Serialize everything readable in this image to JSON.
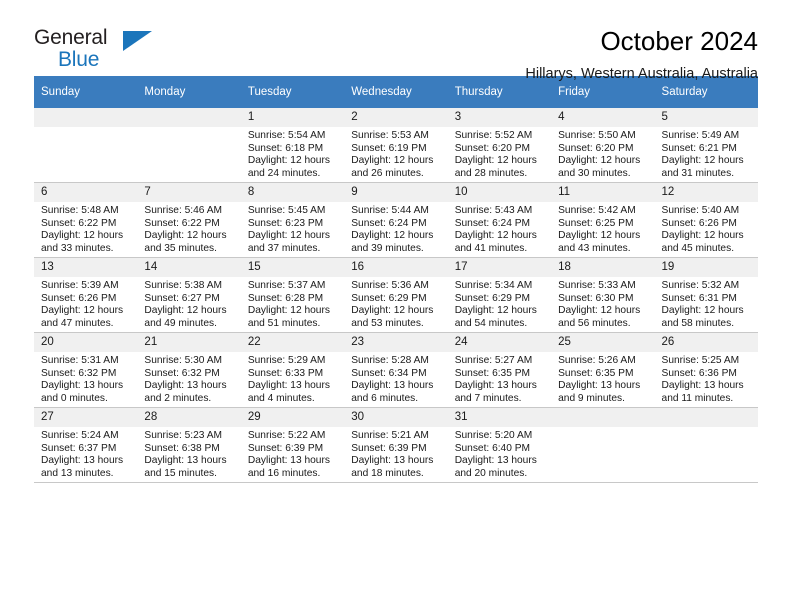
{
  "brand": {
    "name_top": "General",
    "name_bottom": "Blue",
    "triangle_icon": "triangle-icon",
    "accent_color": "#1b75bb"
  },
  "header": {
    "title": "October 2024",
    "subtitle": "Hillarys, Western Australia, Australia"
  },
  "calendar": {
    "header_bg": "#3a7cbe",
    "daynum_bg": "#f0f0f0",
    "weekdays": [
      "Sunday",
      "Monday",
      "Tuesday",
      "Wednesday",
      "Thursday",
      "Friday",
      "Saturday"
    ],
    "labels": {
      "sunrise": "Sunrise:",
      "sunset": "Sunset:",
      "daylight": "Daylight:"
    },
    "weeks": [
      [
        {
          "day": "",
          "empty": true
        },
        {
          "day": "",
          "empty": true
        },
        {
          "day": "1",
          "sunrise": "Sunrise: 5:54 AM",
          "sunset": "Sunset: 6:18 PM",
          "daylight_1": "Daylight: 12 hours",
          "daylight_2": "and 24 minutes."
        },
        {
          "day": "2",
          "sunrise": "Sunrise: 5:53 AM",
          "sunset": "Sunset: 6:19 PM",
          "daylight_1": "Daylight: 12 hours",
          "daylight_2": "and 26 minutes."
        },
        {
          "day": "3",
          "sunrise": "Sunrise: 5:52 AM",
          "sunset": "Sunset: 6:20 PM",
          "daylight_1": "Daylight: 12 hours",
          "daylight_2": "and 28 minutes."
        },
        {
          "day": "4",
          "sunrise": "Sunrise: 5:50 AM",
          "sunset": "Sunset: 6:20 PM",
          "daylight_1": "Daylight: 12 hours",
          "daylight_2": "and 30 minutes."
        },
        {
          "day": "5",
          "sunrise": "Sunrise: 5:49 AM",
          "sunset": "Sunset: 6:21 PM",
          "daylight_1": "Daylight: 12 hours",
          "daylight_2": "and 31 minutes."
        }
      ],
      [
        {
          "day": "6",
          "sunrise": "Sunrise: 5:48 AM",
          "sunset": "Sunset: 6:22 PM",
          "daylight_1": "Daylight: 12 hours",
          "daylight_2": "and 33 minutes."
        },
        {
          "day": "7",
          "sunrise": "Sunrise: 5:46 AM",
          "sunset": "Sunset: 6:22 PM",
          "daylight_1": "Daylight: 12 hours",
          "daylight_2": "and 35 minutes."
        },
        {
          "day": "8",
          "sunrise": "Sunrise: 5:45 AM",
          "sunset": "Sunset: 6:23 PM",
          "daylight_1": "Daylight: 12 hours",
          "daylight_2": "and 37 minutes."
        },
        {
          "day": "9",
          "sunrise": "Sunrise: 5:44 AM",
          "sunset": "Sunset: 6:24 PM",
          "daylight_1": "Daylight: 12 hours",
          "daylight_2": "and 39 minutes."
        },
        {
          "day": "10",
          "sunrise": "Sunrise: 5:43 AM",
          "sunset": "Sunset: 6:24 PM",
          "daylight_1": "Daylight: 12 hours",
          "daylight_2": "and 41 minutes."
        },
        {
          "day": "11",
          "sunrise": "Sunrise: 5:42 AM",
          "sunset": "Sunset: 6:25 PM",
          "daylight_1": "Daylight: 12 hours",
          "daylight_2": "and 43 minutes."
        },
        {
          "day": "12",
          "sunrise": "Sunrise: 5:40 AM",
          "sunset": "Sunset: 6:26 PM",
          "daylight_1": "Daylight: 12 hours",
          "daylight_2": "and 45 minutes."
        }
      ],
      [
        {
          "day": "13",
          "sunrise": "Sunrise: 5:39 AM",
          "sunset": "Sunset: 6:26 PM",
          "daylight_1": "Daylight: 12 hours",
          "daylight_2": "and 47 minutes."
        },
        {
          "day": "14",
          "sunrise": "Sunrise: 5:38 AM",
          "sunset": "Sunset: 6:27 PM",
          "daylight_1": "Daylight: 12 hours",
          "daylight_2": "and 49 minutes."
        },
        {
          "day": "15",
          "sunrise": "Sunrise: 5:37 AM",
          "sunset": "Sunset: 6:28 PM",
          "daylight_1": "Daylight: 12 hours",
          "daylight_2": "and 51 minutes."
        },
        {
          "day": "16",
          "sunrise": "Sunrise: 5:36 AM",
          "sunset": "Sunset: 6:29 PM",
          "daylight_1": "Daylight: 12 hours",
          "daylight_2": "and 53 minutes."
        },
        {
          "day": "17",
          "sunrise": "Sunrise: 5:34 AM",
          "sunset": "Sunset: 6:29 PM",
          "daylight_1": "Daylight: 12 hours",
          "daylight_2": "and 54 minutes."
        },
        {
          "day": "18",
          "sunrise": "Sunrise: 5:33 AM",
          "sunset": "Sunset: 6:30 PM",
          "daylight_1": "Daylight: 12 hours",
          "daylight_2": "and 56 minutes."
        },
        {
          "day": "19",
          "sunrise": "Sunrise: 5:32 AM",
          "sunset": "Sunset: 6:31 PM",
          "daylight_1": "Daylight: 12 hours",
          "daylight_2": "and 58 minutes."
        }
      ],
      [
        {
          "day": "20",
          "sunrise": "Sunrise: 5:31 AM",
          "sunset": "Sunset: 6:32 PM",
          "daylight_1": "Daylight: 13 hours",
          "daylight_2": "and 0 minutes."
        },
        {
          "day": "21",
          "sunrise": "Sunrise: 5:30 AM",
          "sunset": "Sunset: 6:32 PM",
          "daylight_1": "Daylight: 13 hours",
          "daylight_2": "and 2 minutes."
        },
        {
          "day": "22",
          "sunrise": "Sunrise: 5:29 AM",
          "sunset": "Sunset: 6:33 PM",
          "daylight_1": "Daylight: 13 hours",
          "daylight_2": "and 4 minutes."
        },
        {
          "day": "23",
          "sunrise": "Sunrise: 5:28 AM",
          "sunset": "Sunset: 6:34 PM",
          "daylight_1": "Daylight: 13 hours",
          "daylight_2": "and 6 minutes."
        },
        {
          "day": "24",
          "sunrise": "Sunrise: 5:27 AM",
          "sunset": "Sunset: 6:35 PM",
          "daylight_1": "Daylight: 13 hours",
          "daylight_2": "and 7 minutes."
        },
        {
          "day": "25",
          "sunrise": "Sunrise: 5:26 AM",
          "sunset": "Sunset: 6:35 PM",
          "daylight_1": "Daylight: 13 hours",
          "daylight_2": "and 9 minutes."
        },
        {
          "day": "26",
          "sunrise": "Sunrise: 5:25 AM",
          "sunset": "Sunset: 6:36 PM",
          "daylight_1": "Daylight: 13 hours",
          "daylight_2": "and 11 minutes."
        }
      ],
      [
        {
          "day": "27",
          "sunrise": "Sunrise: 5:24 AM",
          "sunset": "Sunset: 6:37 PM",
          "daylight_1": "Daylight: 13 hours",
          "daylight_2": "and 13 minutes."
        },
        {
          "day": "28",
          "sunrise": "Sunrise: 5:23 AM",
          "sunset": "Sunset: 6:38 PM",
          "daylight_1": "Daylight: 13 hours",
          "daylight_2": "and 15 minutes."
        },
        {
          "day": "29",
          "sunrise": "Sunrise: 5:22 AM",
          "sunset": "Sunset: 6:39 PM",
          "daylight_1": "Daylight: 13 hours",
          "daylight_2": "and 16 minutes."
        },
        {
          "day": "30",
          "sunrise": "Sunrise: 5:21 AM",
          "sunset": "Sunset: 6:39 PM",
          "daylight_1": "Daylight: 13 hours",
          "daylight_2": "and 18 minutes."
        },
        {
          "day": "31",
          "sunrise": "Sunrise: 5:20 AM",
          "sunset": "Sunset: 6:40 PM",
          "daylight_1": "Daylight: 13 hours",
          "daylight_2": "and 20 minutes."
        },
        {
          "day": "",
          "empty": true
        },
        {
          "day": "",
          "empty": true
        }
      ]
    ]
  }
}
